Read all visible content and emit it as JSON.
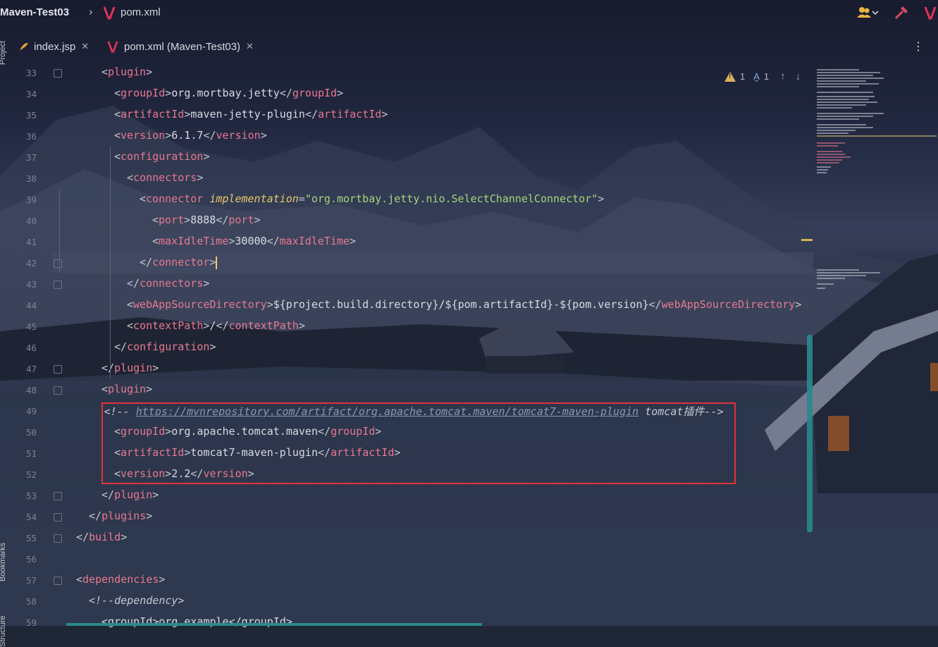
{
  "breadcrumb": {
    "project": "Maven-Test03",
    "file": "pom.xml"
  },
  "side_tools": {
    "project": "Project",
    "bookmarks": "Bookmarks",
    "structure": "Structure"
  },
  "tabs": [
    {
      "label": "index.jsp",
      "icon": "jsp-file-icon"
    },
    {
      "label": "pom.xml (Maven-Test03)",
      "icon": "maven-icon",
      "active": true
    }
  ],
  "inspections": {
    "warnings": "1",
    "typos": "1"
  },
  "colors": {
    "tag": "#e7798f",
    "attribute": "#e6c86b",
    "highlight_box": "#e0333a",
    "scrollbar": "#2a8a8c"
  },
  "lines": [
    {
      "n": "33",
      "indent": 2,
      "parts": [
        [
          "b",
          "<"
        ],
        [
          "t",
          "plugin"
        ],
        [
          "b",
          ">"
        ]
      ]
    },
    {
      "n": "34",
      "indent": 3,
      "parts": [
        [
          "b",
          "<"
        ],
        [
          "t",
          "groupId"
        ],
        [
          "b",
          ">"
        ],
        [
          "v",
          "org.mortbay.jetty"
        ],
        [
          "b",
          "</"
        ],
        [
          "t",
          "groupId"
        ],
        [
          "b",
          ">"
        ]
      ]
    },
    {
      "n": "35",
      "indent": 3,
      "parts": [
        [
          "b",
          "<"
        ],
        [
          "t",
          "artifactId"
        ],
        [
          "b",
          ">"
        ],
        [
          "v",
          "maven-jetty-plugin"
        ],
        [
          "b",
          "</"
        ],
        [
          "t",
          "artifactId"
        ],
        [
          "b",
          ">"
        ]
      ]
    },
    {
      "n": "36",
      "indent": 3,
      "parts": [
        [
          "b",
          "<"
        ],
        [
          "t",
          "version"
        ],
        [
          "b",
          ">"
        ],
        [
          "v",
          "6.1.7"
        ],
        [
          "b",
          "</"
        ],
        [
          "t",
          "version"
        ],
        [
          "b",
          ">"
        ]
      ]
    },
    {
      "n": "37",
      "indent": 3,
      "parts": [
        [
          "b",
          "<"
        ],
        [
          "t",
          "configuration"
        ],
        [
          "b",
          ">"
        ]
      ]
    },
    {
      "n": "38",
      "indent": 4,
      "parts": [
        [
          "b",
          "<"
        ],
        [
          "t",
          "connectors"
        ],
        [
          "b",
          ">"
        ]
      ]
    },
    {
      "n": "39",
      "indent": 5,
      "parts": [
        [
          "b",
          "<"
        ],
        [
          "t",
          "connector "
        ],
        [
          "a",
          "implementation"
        ],
        [
          "b",
          "="
        ],
        [
          "s",
          "\"org.mortbay.jetty.nio.SelectChannelConnector\""
        ],
        [
          "b",
          ">"
        ]
      ]
    },
    {
      "n": "40",
      "indent": 6,
      "parts": [
        [
          "b",
          "<"
        ],
        [
          "t",
          "port"
        ],
        [
          "b",
          ">"
        ],
        [
          "v",
          "8888"
        ],
        [
          "b",
          "</"
        ],
        [
          "t",
          "port"
        ],
        [
          "b",
          ">"
        ]
      ]
    },
    {
      "n": "41",
      "indent": 6,
      "parts": [
        [
          "b",
          "<"
        ],
        [
          "t",
          "maxIdleTime"
        ],
        [
          "b",
          ">"
        ],
        [
          "v",
          "30000"
        ],
        [
          "b",
          "</"
        ],
        [
          "t",
          "maxIdleTime"
        ],
        [
          "b",
          ">"
        ]
      ]
    },
    {
      "n": "42",
      "indent": 5,
      "parts": [
        [
          "b",
          "</"
        ],
        [
          "t",
          "connector"
        ],
        [
          "b",
          ">"
        ]
      ],
      "current": true
    },
    {
      "n": "43",
      "indent": 4,
      "parts": [
        [
          "b",
          "</"
        ],
        [
          "t",
          "connectors"
        ],
        [
          "b",
          ">"
        ]
      ]
    },
    {
      "n": "44",
      "indent": 4,
      "parts": [
        [
          "b",
          "<"
        ],
        [
          "t",
          "webAppSourceDirectory"
        ],
        [
          "b",
          ">"
        ],
        [
          "v",
          "${project.build.directory}/${pom.artifactId}-${pom.version}"
        ],
        [
          "b",
          "</"
        ],
        [
          "t",
          "webAppSourceDirectory"
        ],
        [
          "b",
          ">"
        ]
      ]
    },
    {
      "n": "45",
      "indent": 4,
      "parts": [
        [
          "b",
          "<"
        ],
        [
          "t",
          "contextPath"
        ],
        [
          "b",
          ">"
        ],
        [
          "v",
          "/"
        ],
        [
          "b",
          "</"
        ],
        [
          "t",
          "contextPath"
        ],
        [
          "b",
          ">"
        ]
      ]
    },
    {
      "n": "46",
      "indent": 3,
      "parts": [
        [
          "b",
          "</"
        ],
        [
          "t",
          "configuration"
        ],
        [
          "b",
          ">"
        ]
      ]
    },
    {
      "n": "47",
      "indent": 2,
      "parts": [
        [
          "b",
          "</"
        ],
        [
          "t",
          "plugin"
        ],
        [
          "b",
          ">"
        ]
      ]
    },
    {
      "n": "48",
      "indent": 2,
      "parts": [
        [
          "b",
          "<"
        ],
        [
          "t",
          "plugin"
        ],
        [
          "b",
          ">"
        ]
      ]
    },
    {
      "n": "49",
      "indent": 2.2,
      "parts": [
        [
          "c",
          "<!-- "
        ],
        [
          "link",
          "https://mvnrepository.com/artifact/org.apache.tomcat.maven/tomcat7-maven-plugin"
        ],
        [
          "c",
          " tomcat插件-->"
        ]
      ]
    },
    {
      "n": "50",
      "indent": 3,
      "parts": [
        [
          "b",
          "<"
        ],
        [
          "t",
          "groupId"
        ],
        [
          "b",
          ">"
        ],
        [
          "v",
          "org.apache.tomcat.maven"
        ],
        [
          "b",
          "</"
        ],
        [
          "t",
          "groupId"
        ],
        [
          "b",
          ">"
        ]
      ]
    },
    {
      "n": "51",
      "indent": 3,
      "parts": [
        [
          "b",
          "<"
        ],
        [
          "t",
          "artifactId"
        ],
        [
          "b",
          ">"
        ],
        [
          "v",
          "tomcat7-maven-plugin"
        ],
        [
          "b",
          "</"
        ],
        [
          "t",
          "artifactId"
        ],
        [
          "b",
          ">"
        ]
      ]
    },
    {
      "n": "52",
      "indent": 3,
      "parts": [
        [
          "b",
          "<"
        ],
        [
          "t",
          "version"
        ],
        [
          "b",
          ">"
        ],
        [
          "v",
          "2.2"
        ],
        [
          "b",
          "</"
        ],
        [
          "t",
          "version"
        ],
        [
          "b",
          ">"
        ]
      ]
    },
    {
      "n": "53",
      "indent": 2,
      "parts": [
        [
          "b",
          "</"
        ],
        [
          "t",
          "plugin"
        ],
        [
          "b",
          ">"
        ]
      ]
    },
    {
      "n": "54",
      "indent": 1,
      "parts": [
        [
          "b",
          "</"
        ],
        [
          "t",
          "plugins"
        ],
        [
          "b",
          ">"
        ]
      ]
    },
    {
      "n": "55",
      "indent": 0,
      "parts": [
        [
          "b",
          "</"
        ],
        [
          "t",
          "build"
        ],
        [
          "b",
          ">"
        ]
      ]
    },
    {
      "n": "56",
      "indent": 0,
      "parts": []
    },
    {
      "n": "57",
      "indent": 0,
      "parts": [
        [
          "b",
          "<"
        ],
        [
          "t",
          "dependencies"
        ],
        [
          "b",
          ">"
        ]
      ]
    },
    {
      "n": "58",
      "indent": 1,
      "parts": [
        [
          "c",
          "<!--dependency>"
        ]
      ]
    },
    {
      "n": "59",
      "indent": 2,
      "parts": [
        [
          "v",
          "<groupId>org.example</groupId>"
        ]
      ]
    }
  ]
}
